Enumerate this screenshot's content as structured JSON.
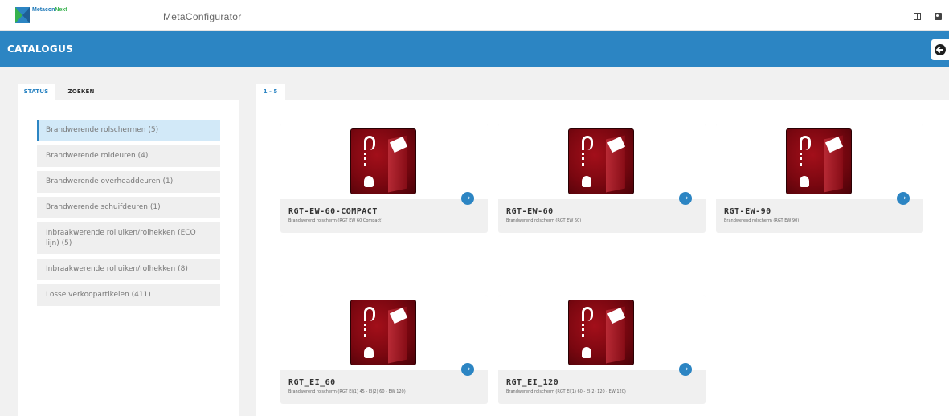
{
  "topbar": {
    "logo_metacon": "Metacon",
    "logo_next": "Next",
    "app_title": "MetaConfigurator"
  },
  "header": {
    "title": "CATALOGUS"
  },
  "left_panel": {
    "tabs": [
      {
        "label": "STATUS",
        "active": true
      },
      {
        "label": "ZOEKEN",
        "active": false
      }
    ],
    "categories": [
      {
        "label": "Brandwerende rolschermen (5)",
        "active": true
      },
      {
        "label": "Brandwerende roldeuren (4)",
        "active": false
      },
      {
        "label": "Brandwerende overheaddeuren (1)",
        "active": false
      },
      {
        "label": "Brandwerende schuifdeuren (1)",
        "active": false
      },
      {
        "label": "Inbraakwerende rolluiken/rolhekken (ECO lijn) (5)",
        "active": false
      },
      {
        "label": "Inbraakwerende rolluiken/rolhekken (8)",
        "active": false
      },
      {
        "label": "Losse verkoopartikelen (411)",
        "active": false
      }
    ]
  },
  "right_panel": {
    "page_tab": "1 - 5",
    "products": [
      {
        "title": "RGT-EW-60-COMPACT",
        "subtitle": "Brandwerend rolscherm (RGT EW 60 Compact)"
      },
      {
        "title": "RGT-EW-60",
        "subtitle": "Brandwerend rolscherm (RGT EW 60)"
      },
      {
        "title": "RGT-EW-90",
        "subtitle": "Brandwerend rolscherm (RGT EW 90)"
      },
      {
        "title": "RGT_EI_60",
        "subtitle": "Brandwerend rolscherm (RGT EI(1) 45 - EI(2) 60 - EW 120)"
      },
      {
        "title": "RGT_EI_120",
        "subtitle": "Brandwerend rolscherm (RGT EI(1) 60 - EI(2) 120 - EW 120)"
      }
    ]
  },
  "icons": {
    "logo": "metacon-logo-icon",
    "sidebar_toggle": "sidebar-toggle-icon",
    "user": "user-icon",
    "back": "arrow-left-circle-icon",
    "card_arrow": "arrow-right-circle-icon"
  },
  "colors": {
    "accent": "#2c85c3",
    "active_item_bg": "#d2e9f8",
    "product_red": "#8a0d17"
  }
}
